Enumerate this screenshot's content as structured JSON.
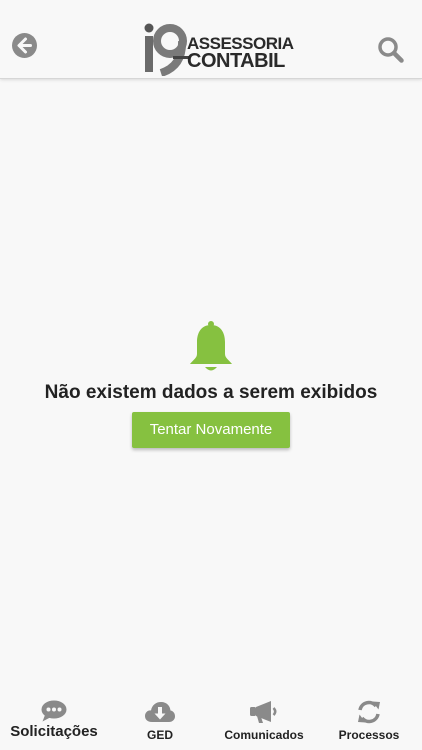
{
  "header": {
    "logo_line1": "ASSESSORIA",
    "logo_line2": "CONTABIL",
    "logo_mark": "i9"
  },
  "icons": {
    "back": "arrow-left-circle-icon",
    "search": "search-icon",
    "bell": "bell-icon"
  },
  "empty_state": {
    "message": "Não existem dados a serem exibidos",
    "button_label": "Tentar Novamente"
  },
  "tabs": [
    {
      "label": "Solicitações",
      "icon": "chat-bubble-icon",
      "active": true
    },
    {
      "label": "GED",
      "icon": "cloud-download-icon",
      "active": false
    },
    {
      "label": "Comunicados",
      "icon": "megaphone-icon",
      "active": false
    },
    {
      "label": "Processos",
      "icon": "refresh-icon",
      "active": false
    }
  ],
  "colors": {
    "accent": "#86c140",
    "icon_gray": "#8a8a8a",
    "background": "#f8f8f8",
    "text": "#222222"
  }
}
